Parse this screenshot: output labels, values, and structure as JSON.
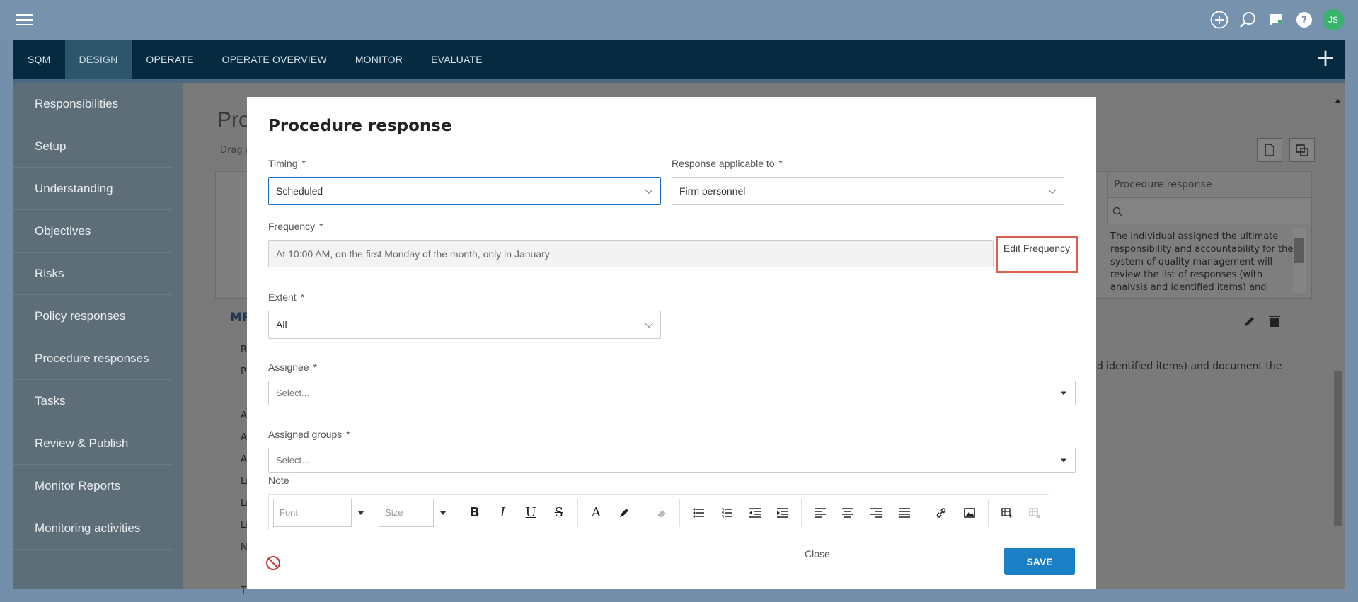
{
  "user": {
    "initials": "JS"
  },
  "nav": {
    "tabs": [
      "SQM",
      "DESIGN",
      "OPERATE",
      "OPERATE OVERVIEW",
      "MONITOR",
      "EVALUATE"
    ],
    "active": "DESIGN"
  },
  "sidebar": {
    "items": [
      "Responsibilities",
      "Setup",
      "Understanding",
      "Objectives",
      "Risks",
      "Policy responses",
      "Procedure responses",
      "Tasks",
      "Review & Publish",
      "Monitor Reports",
      "Monitoring activities"
    ]
  },
  "background": {
    "title": "Pro",
    "subtitle": "Drag a",
    "column_header": "Procedure response",
    "cell_text": "The individual assigned the ultimate responsibility and accountability for the system of quality management will review the list of responses (with analysis and identified items) and document the",
    "section_heading": "MF",
    "row_text": "nd identified items) and document the",
    "row_letters": [
      "R",
      "P",
      "",
      "A",
      "A",
      "A",
      "Li",
      "Li",
      "Li",
      "N",
      "",
      "T"
    ]
  },
  "modal": {
    "title": "Procedure response",
    "timing": {
      "label": "Timing",
      "value": "Scheduled"
    },
    "response_applicable_to": {
      "label": "Response applicable to",
      "value": "Firm personnel"
    },
    "frequency": {
      "label": "Frequency",
      "value": "At 10:00 AM, on the first Monday of the month, only in January",
      "edit_label": "Edit Frequency"
    },
    "extent": {
      "label": "Extent",
      "value": "All"
    },
    "assignee": {
      "label": "Assignee",
      "placeholder": "Select..."
    },
    "assigned_groups": {
      "label": "Assigned groups",
      "placeholder": "Select..."
    },
    "note": {
      "label": "Note",
      "font_placeholder": "Font",
      "size_placeholder": "Size"
    },
    "required_marker": "*",
    "close_label": "Close",
    "save_label": "SAVE"
  },
  "colors": {
    "primary": "#1a7fc4",
    "highlight": "#d9604c",
    "nav_bg": "#062b40",
    "avatar": "#37b36b"
  }
}
